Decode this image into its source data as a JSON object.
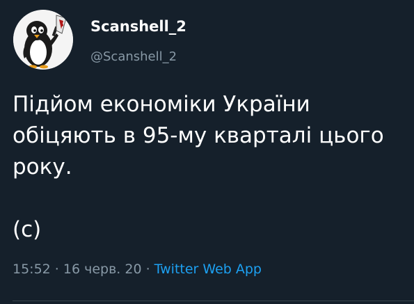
{
  "tweet": {
    "author": {
      "display_name": "Scanshell_2",
      "handle": "@Scanshell_2",
      "avatar_icon": "penguin-with-knife-icon"
    },
    "text": "Підйом економіки України обіцяють в 95-му кварталі цього року.\n\n(с)",
    "meta": {
      "time": "15:52",
      "separator": " · ",
      "date": "16 черв. 20",
      "source": "Twitter Web App"
    }
  },
  "colors": {
    "background": "#15202b",
    "primary_text": "#ffffff",
    "secondary_text": "#8899a6",
    "link": "#1da1f2",
    "divider": "#38444d"
  }
}
